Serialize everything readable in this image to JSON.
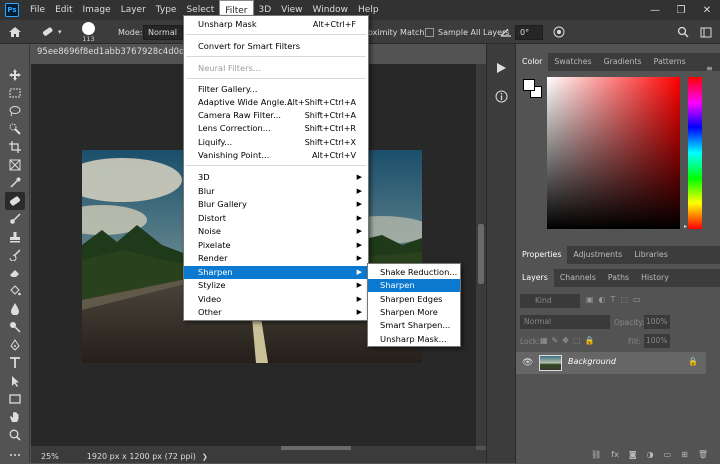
{
  "app": {
    "logo": "Ps"
  },
  "menubar": {
    "items": [
      "File",
      "Edit",
      "Image",
      "Layer",
      "Type",
      "Select",
      "Filter",
      "3D",
      "View",
      "Window",
      "Help"
    ],
    "active": "Filter"
  },
  "window_controls": {
    "minimize": "—",
    "restore": "❐",
    "close": "✕"
  },
  "options_bar": {
    "brush_size": "113",
    "mode_label": "Mode:",
    "mode_value": "Normal",
    "proximity_match": "oximity Match",
    "sample_all_layers": "Sample All Layers",
    "angle_value": "0°"
  },
  "document": {
    "tab_title": "95ee8696f8ed1abb3767928c4d0daf65-l",
    "zoom": "25%",
    "dimensions": "1920 px x 1200 px (72 ppi)"
  },
  "filter_menu": {
    "items": [
      {
        "label": "Unsharp Mask",
        "shortcut": "Alt+Ctrl+F"
      },
      {
        "label": "Convert for Smart Filters"
      },
      {
        "label": "Neural Filters..."
      },
      {
        "label": "Filter Gallery..."
      },
      {
        "label": "Adaptive Wide Angle...",
        "shortcut": "Alt+Shift+Ctrl+A"
      },
      {
        "label": "Camera Raw Filter...",
        "shortcut": "Shift+Ctrl+A"
      },
      {
        "label": "Lens Correction...",
        "shortcut": "Shift+Ctrl+R"
      },
      {
        "label": "Liquify...",
        "shortcut": "Shift+Ctrl+X"
      },
      {
        "label": "Vanishing Point...",
        "shortcut": "Alt+Ctrl+V"
      },
      {
        "label": "3D"
      },
      {
        "label": "Blur"
      },
      {
        "label": "Blur Gallery"
      },
      {
        "label": "Distort"
      },
      {
        "label": "Noise"
      },
      {
        "label": "Pixelate"
      },
      {
        "label": "Render"
      },
      {
        "label": "Sharpen"
      },
      {
        "label": "Stylize"
      },
      {
        "label": "Video"
      },
      {
        "label": "Other"
      }
    ]
  },
  "sharpen_submenu": {
    "items": [
      "Shake Reduction...",
      "Sharpen",
      "Sharpen Edges",
      "Sharpen More",
      "Smart Sharpen...",
      "Unsharp Mask..."
    ]
  },
  "color_panel": {
    "tabs": [
      "Color",
      "Swatches",
      "Gradients",
      "Patterns"
    ]
  },
  "properties_panel": {
    "tabs": [
      "Properties",
      "Adjustments",
      "Libraries"
    ]
  },
  "layers_panel": {
    "tabs": [
      "Layers",
      "Channels",
      "Paths",
      "History"
    ],
    "kind_label": "Kind",
    "blend_mode": "Normal",
    "opacity_label": "Opacity:",
    "opacity_value": "100%",
    "lock_label": "Lock:",
    "fill_label": "Fill:",
    "fill_value": "100%",
    "layers": [
      {
        "name": "Background"
      }
    ]
  }
}
